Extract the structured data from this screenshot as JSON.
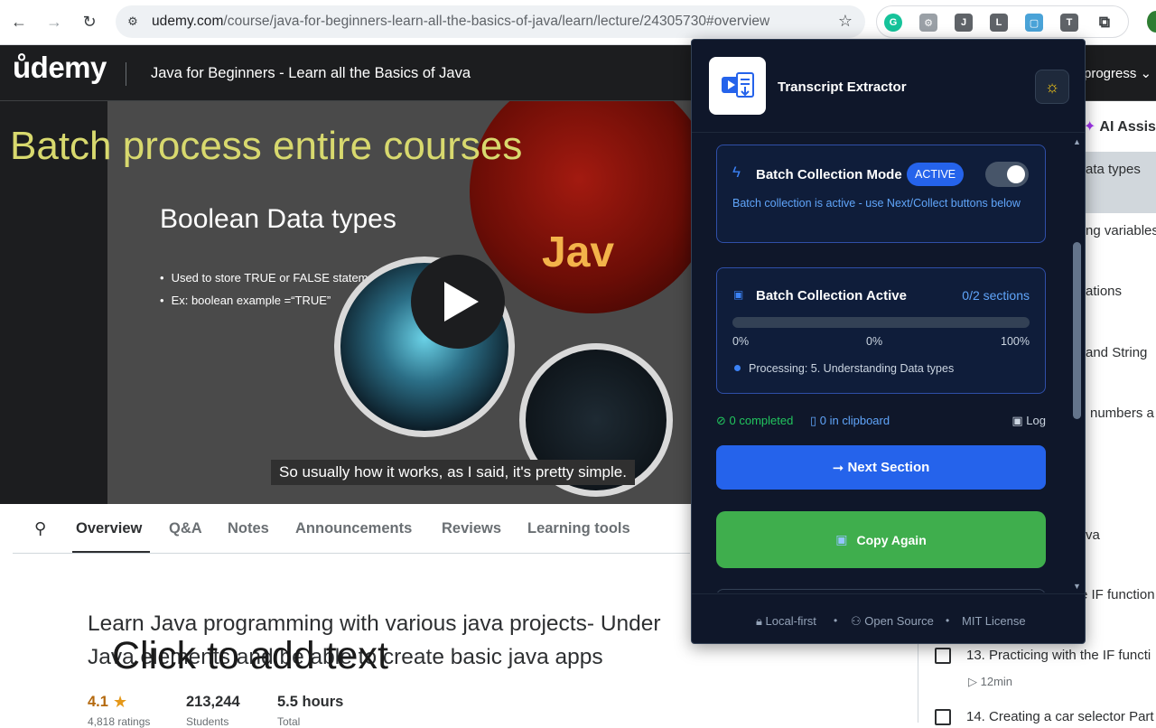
{
  "browser": {
    "url_host": "udemy.com",
    "url_path": "/course/java-for-beginners-learn-all-the-basics-of-java/learn/lecture/24305730#overview",
    "extensions": [
      {
        "name": "grammarly",
        "glyph": "G",
        "color": "#15c39a"
      },
      {
        "name": "puzzle-helper",
        "glyph": "⚙",
        "color": "#9aa0a6"
      },
      {
        "name": "j-extension",
        "glyph": "J",
        "color": "#5f6368"
      },
      {
        "name": "l-extension",
        "glyph": "L",
        "color": "#5f6368"
      },
      {
        "name": "frame-extension",
        "glyph": "▢",
        "color": "#4aa3d8"
      },
      {
        "name": "t-extension",
        "glyph": "T",
        "color": "#5f6368"
      }
    ]
  },
  "header": {
    "logo_text": "ůdemy",
    "course_title": "Java for Beginners - Learn all the Basics of Java",
    "progress_label": "progress ⌄"
  },
  "video": {
    "overlay_banner": "Batch process entire courses",
    "slide_heading": "Boolean Data types",
    "slide_bullets": [
      "Used to store TRUE or FALSE statements",
      "Ex: boolean example =“TRUE”"
    ],
    "logo_fragment": "Jav",
    "caption": "So usually how it works, as I said, it's pretty simple."
  },
  "tabs": [
    "Overview",
    "Q&A",
    "Notes",
    "Announcements",
    "Reviews",
    "Learning tools"
  ],
  "overview": {
    "line1": "Learn Java programming with various java projects- Under",
    "line2": "Java elements and be able to create basic java apps",
    "click_overlay": "Click to add text",
    "rating": "4.1",
    "students": "213,244",
    "hours": "5.5 hours",
    "rating_sub": "4,818 ratings",
    "students_sub": "Students",
    "hours_sub": "Total"
  },
  "sidebar": {
    "ai_assist": "AI Assis",
    "fragments": [
      "ata types",
      "ng variables",
      "ations",
      "and String",
      "numbers a",
      "va",
      "e IF function"
    ],
    "lessons": [
      {
        "title": "13. Practicing with the IF functi",
        "meta": "12min"
      },
      {
        "title": "14. Creating a car selector Part"
      }
    ]
  },
  "popup": {
    "title": "Transcript Extractor",
    "batch_mode": {
      "title": "Batch Collection Mode",
      "badge": "ACTIVE",
      "enabled": true,
      "description": "Batch collection is active - use Next/Collect buttons below"
    },
    "batch_active": {
      "title": "Batch Collection Active",
      "count": "0/2 sections",
      "progress": 0,
      "tick_left": "0%",
      "tick_mid": "0%",
      "tick_right": "100%",
      "processing": "Processing: 5. Understanding Data types"
    },
    "status": {
      "completed": "0 completed",
      "clipboard": "0 in clipboard",
      "log": "Log"
    },
    "next_button": "Next Section",
    "copy_button": "Copy Again",
    "footer": [
      "Local-first",
      "Open Source",
      "MIT License"
    ],
    "colors": {
      "primary": "#2563eb",
      "success": "#3fae4d",
      "background": "#0f172a"
    }
  }
}
